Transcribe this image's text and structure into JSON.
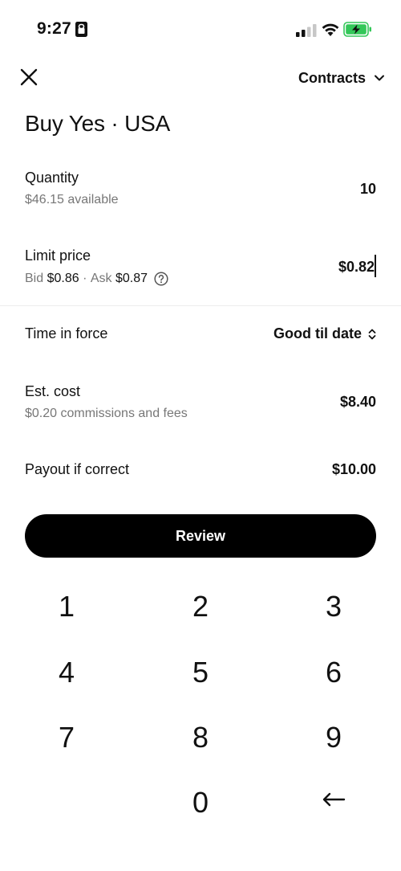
{
  "status_bar": {
    "time": "9:27",
    "icons": [
      "lock-icon",
      "signal-icon",
      "wifi-icon",
      "battery-charging-icon"
    ],
    "battery_color": "#34c759"
  },
  "header": {
    "close_icon": "close-icon",
    "contracts_label": "Contracts",
    "contracts_icon": "chevron-down-icon"
  },
  "title": "Buy Yes · USA",
  "order": {
    "quantity": {
      "label": "Quantity",
      "available": "$46.15 available",
      "value": "10"
    },
    "limit_price": {
      "label": "Limit price",
      "bid_label": "Bid",
      "bid_value": "$0.86",
      "separator": " · ",
      "ask_label": "Ask",
      "ask_value": "$0.87",
      "value": "$0.82",
      "help_icon": "question-circle-icon"
    },
    "time_in_force": {
      "label": "Time in force",
      "value": "Good til date",
      "icon": "sort-arrows-icon"
    },
    "est_cost": {
      "label": "Est. cost",
      "fees": "$0.20 commissions and fees",
      "value": "$8.40"
    },
    "payout": {
      "label": "Payout if correct",
      "value": "$10.00"
    }
  },
  "review_button": "Review",
  "keypad": {
    "keys": [
      "1",
      "2",
      "3",
      "4",
      "5",
      "6",
      "7",
      "8",
      "9",
      "0"
    ],
    "backspace_icon": "arrow-left-icon"
  }
}
